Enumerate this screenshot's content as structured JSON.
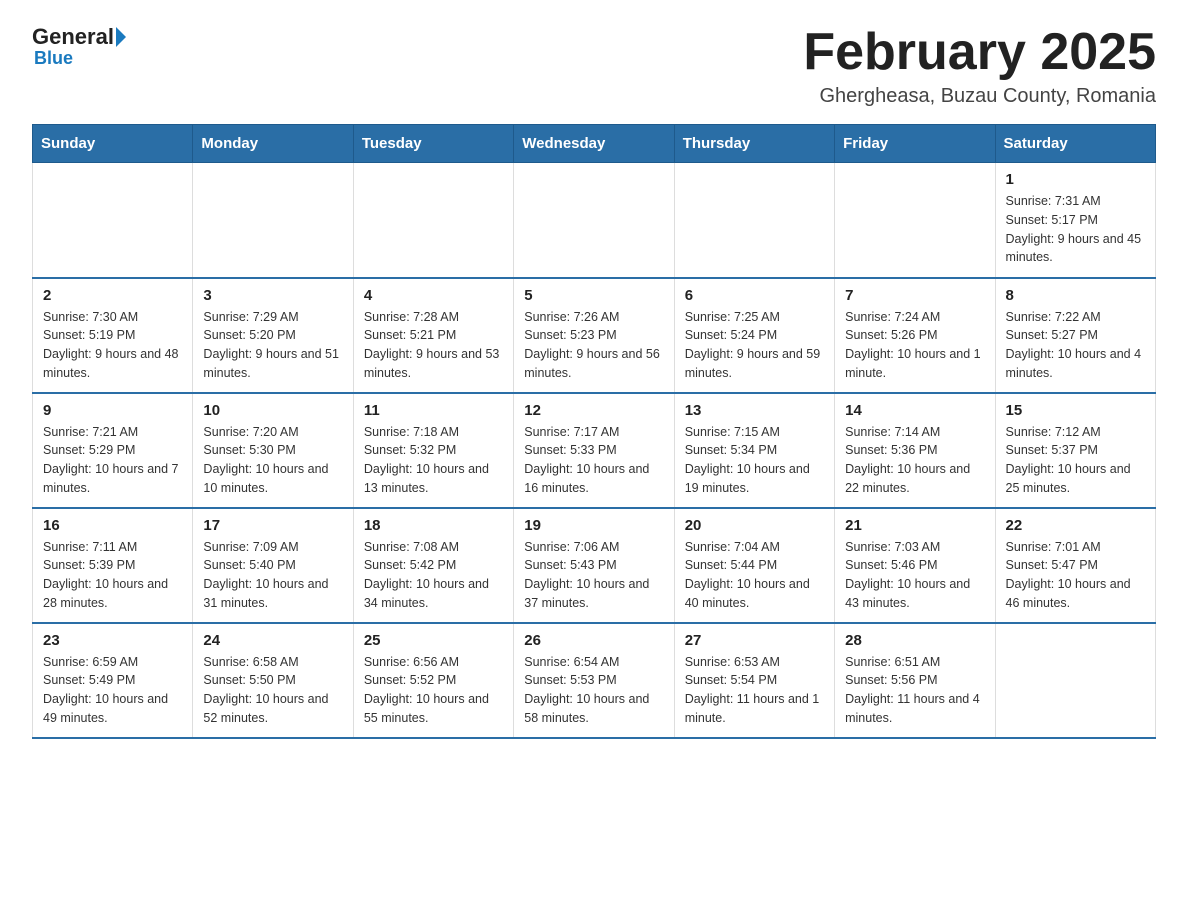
{
  "header": {
    "logo_text": "General",
    "logo_blue": "Blue",
    "main_title": "February 2025",
    "subtitle": "Ghergheasa, Buzau County, Romania"
  },
  "calendar": {
    "days_of_week": [
      "Sunday",
      "Monday",
      "Tuesday",
      "Wednesday",
      "Thursday",
      "Friday",
      "Saturday"
    ],
    "weeks": [
      [
        {
          "day": "",
          "info": ""
        },
        {
          "day": "",
          "info": ""
        },
        {
          "day": "",
          "info": ""
        },
        {
          "day": "",
          "info": ""
        },
        {
          "day": "",
          "info": ""
        },
        {
          "day": "",
          "info": ""
        },
        {
          "day": "1",
          "info": "Sunrise: 7:31 AM\nSunset: 5:17 PM\nDaylight: 9 hours and 45 minutes."
        }
      ],
      [
        {
          "day": "2",
          "info": "Sunrise: 7:30 AM\nSunset: 5:19 PM\nDaylight: 9 hours and 48 minutes."
        },
        {
          "day": "3",
          "info": "Sunrise: 7:29 AM\nSunset: 5:20 PM\nDaylight: 9 hours and 51 minutes."
        },
        {
          "day": "4",
          "info": "Sunrise: 7:28 AM\nSunset: 5:21 PM\nDaylight: 9 hours and 53 minutes."
        },
        {
          "day": "5",
          "info": "Sunrise: 7:26 AM\nSunset: 5:23 PM\nDaylight: 9 hours and 56 minutes."
        },
        {
          "day": "6",
          "info": "Sunrise: 7:25 AM\nSunset: 5:24 PM\nDaylight: 9 hours and 59 minutes."
        },
        {
          "day": "7",
          "info": "Sunrise: 7:24 AM\nSunset: 5:26 PM\nDaylight: 10 hours and 1 minute."
        },
        {
          "day": "8",
          "info": "Sunrise: 7:22 AM\nSunset: 5:27 PM\nDaylight: 10 hours and 4 minutes."
        }
      ],
      [
        {
          "day": "9",
          "info": "Sunrise: 7:21 AM\nSunset: 5:29 PM\nDaylight: 10 hours and 7 minutes."
        },
        {
          "day": "10",
          "info": "Sunrise: 7:20 AM\nSunset: 5:30 PM\nDaylight: 10 hours and 10 minutes."
        },
        {
          "day": "11",
          "info": "Sunrise: 7:18 AM\nSunset: 5:32 PM\nDaylight: 10 hours and 13 minutes."
        },
        {
          "day": "12",
          "info": "Sunrise: 7:17 AM\nSunset: 5:33 PM\nDaylight: 10 hours and 16 minutes."
        },
        {
          "day": "13",
          "info": "Sunrise: 7:15 AM\nSunset: 5:34 PM\nDaylight: 10 hours and 19 minutes."
        },
        {
          "day": "14",
          "info": "Sunrise: 7:14 AM\nSunset: 5:36 PM\nDaylight: 10 hours and 22 minutes."
        },
        {
          "day": "15",
          "info": "Sunrise: 7:12 AM\nSunset: 5:37 PM\nDaylight: 10 hours and 25 minutes."
        }
      ],
      [
        {
          "day": "16",
          "info": "Sunrise: 7:11 AM\nSunset: 5:39 PM\nDaylight: 10 hours and 28 minutes."
        },
        {
          "day": "17",
          "info": "Sunrise: 7:09 AM\nSunset: 5:40 PM\nDaylight: 10 hours and 31 minutes."
        },
        {
          "day": "18",
          "info": "Sunrise: 7:08 AM\nSunset: 5:42 PM\nDaylight: 10 hours and 34 minutes."
        },
        {
          "day": "19",
          "info": "Sunrise: 7:06 AM\nSunset: 5:43 PM\nDaylight: 10 hours and 37 minutes."
        },
        {
          "day": "20",
          "info": "Sunrise: 7:04 AM\nSunset: 5:44 PM\nDaylight: 10 hours and 40 minutes."
        },
        {
          "day": "21",
          "info": "Sunrise: 7:03 AM\nSunset: 5:46 PM\nDaylight: 10 hours and 43 minutes."
        },
        {
          "day": "22",
          "info": "Sunrise: 7:01 AM\nSunset: 5:47 PM\nDaylight: 10 hours and 46 minutes."
        }
      ],
      [
        {
          "day": "23",
          "info": "Sunrise: 6:59 AM\nSunset: 5:49 PM\nDaylight: 10 hours and 49 minutes."
        },
        {
          "day": "24",
          "info": "Sunrise: 6:58 AM\nSunset: 5:50 PM\nDaylight: 10 hours and 52 minutes."
        },
        {
          "day": "25",
          "info": "Sunrise: 6:56 AM\nSunset: 5:52 PM\nDaylight: 10 hours and 55 minutes."
        },
        {
          "day": "26",
          "info": "Sunrise: 6:54 AM\nSunset: 5:53 PM\nDaylight: 10 hours and 58 minutes."
        },
        {
          "day": "27",
          "info": "Sunrise: 6:53 AM\nSunset: 5:54 PM\nDaylight: 11 hours and 1 minute."
        },
        {
          "day": "28",
          "info": "Sunrise: 6:51 AM\nSunset: 5:56 PM\nDaylight: 11 hours and 4 minutes."
        },
        {
          "day": "",
          "info": ""
        }
      ]
    ]
  }
}
